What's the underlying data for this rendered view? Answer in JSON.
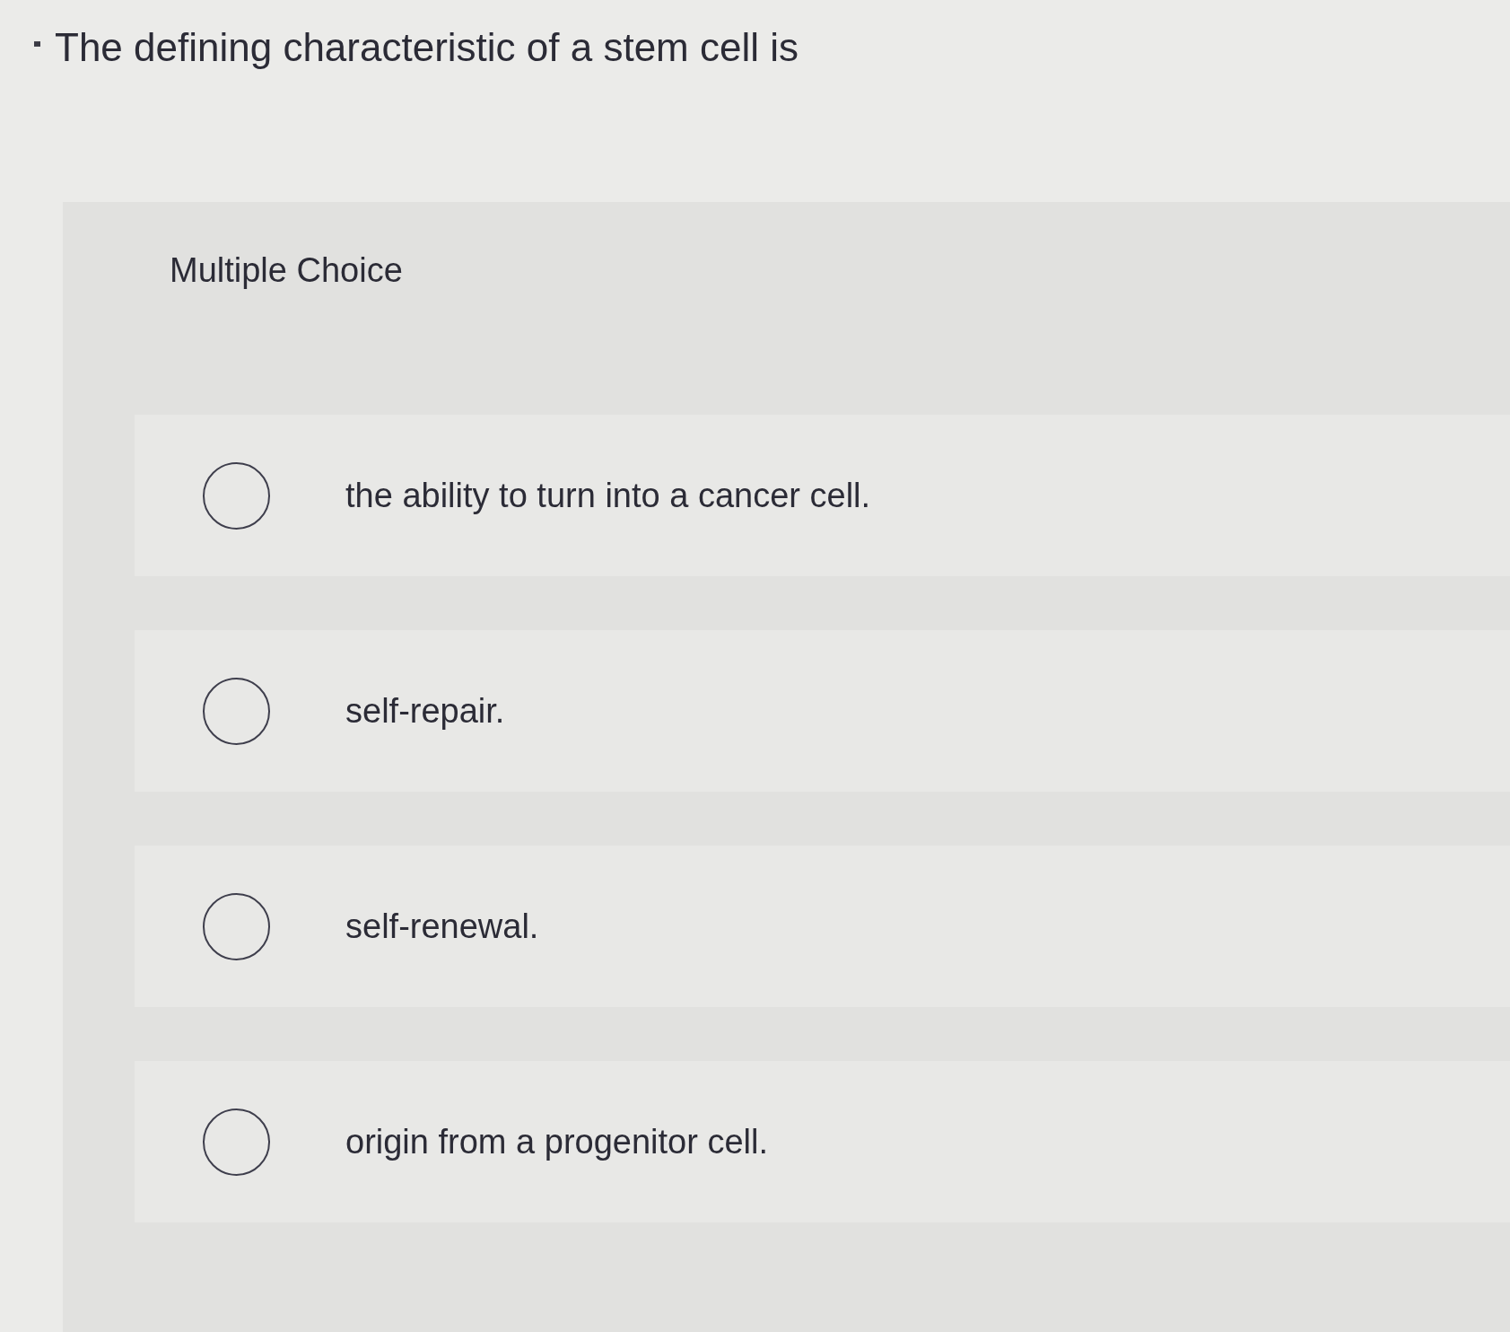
{
  "question": {
    "text": "The defining characteristic of a stem cell is"
  },
  "panel": {
    "heading": "Multiple Choice"
  },
  "options": [
    {
      "label": "the ability to turn into a cancer cell.",
      "selected": false
    },
    {
      "label": "self-repair.",
      "selected": false
    },
    {
      "label": "self-renewal.",
      "selected": false
    },
    {
      "label": "origin from a progenitor cell.",
      "selected": false
    }
  ]
}
